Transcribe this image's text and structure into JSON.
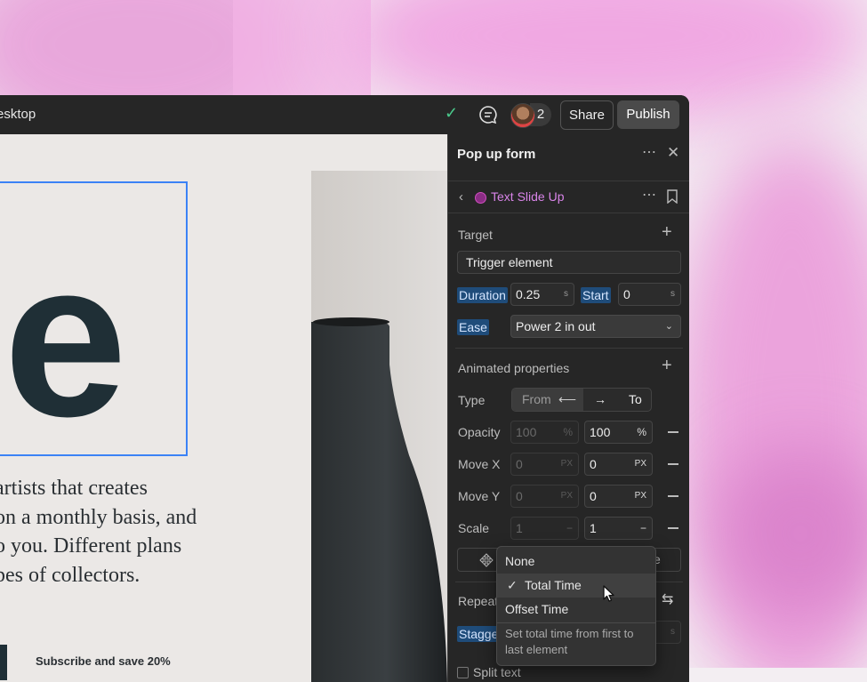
{
  "topbar": {
    "title": "esktop",
    "collaborator_count": "2",
    "share_label": "Share",
    "publish_label": "Publish"
  },
  "canvas": {
    "big_letter": "e",
    "body_lines": [
      "artists that creates",
      "on a monthly basis, and",
      "o you. Different plans",
      "pes of collectors."
    ],
    "subscribe_text": "Subscribe and save 20%"
  },
  "panel": {
    "title": "Pop up form",
    "animation_name": "Text Slide Up",
    "animation_color": "#d04fc0",
    "target_label": "Target",
    "target_value": "Trigger element",
    "duration_label": "Duration",
    "duration_value": "0.25",
    "duration_unit": "s",
    "start_label": "Start",
    "start_value": "0",
    "start_unit": "s",
    "ease_label": "Ease",
    "ease_value": "Power 2 in out",
    "animated_label": "Animated properties",
    "type_label": "Type",
    "type_from": "From",
    "type_to": "To",
    "props": [
      {
        "label": "Opacity",
        "from": "100",
        "from_unit": "%",
        "to": "100",
        "to_unit": "%"
      },
      {
        "label": "Move X",
        "from": "0",
        "from_unit": "PX",
        "to": "0",
        "to_unit": "PX"
      },
      {
        "label": "Move Y",
        "from": "0",
        "from_unit": "PX",
        "to": "0",
        "to_unit": "PX"
      },
      {
        "label": "Scale",
        "from": "1",
        "from_unit": "−",
        "to": "1",
        "to_unit": "−"
      }
    ],
    "partial_button_text": "e",
    "repeat_label": "Repeat",
    "stagger_label": "Stagge",
    "stagger_unit": "s",
    "split_label": "Split text"
  },
  "dropdown": {
    "items": [
      "None",
      "Total Time",
      "Offset Time"
    ],
    "selected": "Total Time",
    "hint": "Set total time from first to last element"
  }
}
